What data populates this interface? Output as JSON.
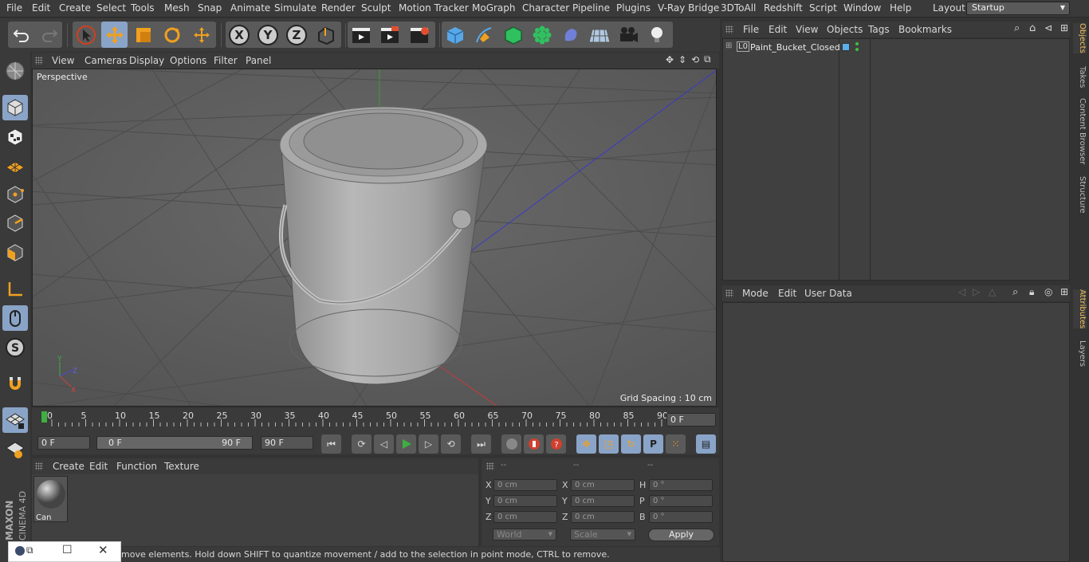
{
  "menubar": {
    "items": [
      "File",
      "Edit",
      "Create",
      "Select",
      "Tools",
      "Mesh",
      "Snap",
      "Animate",
      "Simulate",
      "Render",
      "Sculpt",
      "Motion Tracker",
      "MoGraph",
      "Character",
      "Pipeline",
      "Plugins",
      "V-Ray Bridge",
      "3DToAll",
      "Redshift",
      "Script",
      "Window",
      "Help"
    ],
    "layout_label": "Layout:",
    "layout_value": "Startup"
  },
  "viewport": {
    "menu": [
      "View",
      "Cameras",
      "Display",
      "Options",
      "Filter",
      "Panel"
    ],
    "label": "Perspective",
    "grid_spacing": "Grid Spacing : 10 cm"
  },
  "timeline": {
    "ticks": [
      "0",
      "5",
      "10",
      "15",
      "20",
      "25",
      "30",
      "35",
      "40",
      "45",
      "50",
      "55",
      "60",
      "65",
      "70",
      "75",
      "80",
      "85",
      "90"
    ],
    "current_frame": "0 F"
  },
  "transport": {
    "start": "0 F",
    "range_start": "0 F",
    "range_end": "90 F",
    "end": "90 F"
  },
  "material": {
    "menu": [
      "Create",
      "Edit",
      "Function",
      "Texture"
    ],
    "items": [
      {
        "name": "Can"
      }
    ]
  },
  "coords": {
    "headers": [
      "--",
      "--",
      "--"
    ],
    "rows": [
      {
        "l1": "X",
        "v1": "0 cm",
        "l2": "X",
        "v2": "0 cm",
        "l3": "H",
        "v3": "0 °"
      },
      {
        "l1": "Y",
        "v1": "0 cm",
        "l2": "Y",
        "v2": "0 cm",
        "l3": "P",
        "v3": "0 °"
      },
      {
        "l1": "Z",
        "v1": "0 cm",
        "l2": "Z",
        "v2": "0 cm",
        "l3": "B",
        "v3": "0 °"
      }
    ],
    "mode_world": "World",
    "mode_scale": "Scale",
    "apply": "Apply"
  },
  "status": "move elements. Hold down SHIFT to quantize movement / add to the selection in point mode, CTRL to remove.",
  "object_manager": {
    "menu": [
      "File",
      "Edit",
      "View",
      "Objects",
      "Tags",
      "Bookmarks"
    ],
    "objects": [
      {
        "name": "Paint_Bucket_Closed",
        "icon": "L0"
      }
    ]
  },
  "attributes": {
    "menu": [
      "Mode",
      "Edit",
      "User Data"
    ]
  },
  "right_tabs": [
    "Objects",
    "Takes",
    "Content Browser",
    "Structure",
    "Attributes",
    "Layers"
  ],
  "brand": {
    "line1": "MAXON",
    "line2": "CINEMA 4D"
  },
  "colors": {
    "accent": "#8aa4c8",
    "tab_active": "#f0c060",
    "play": "#3cb040"
  }
}
